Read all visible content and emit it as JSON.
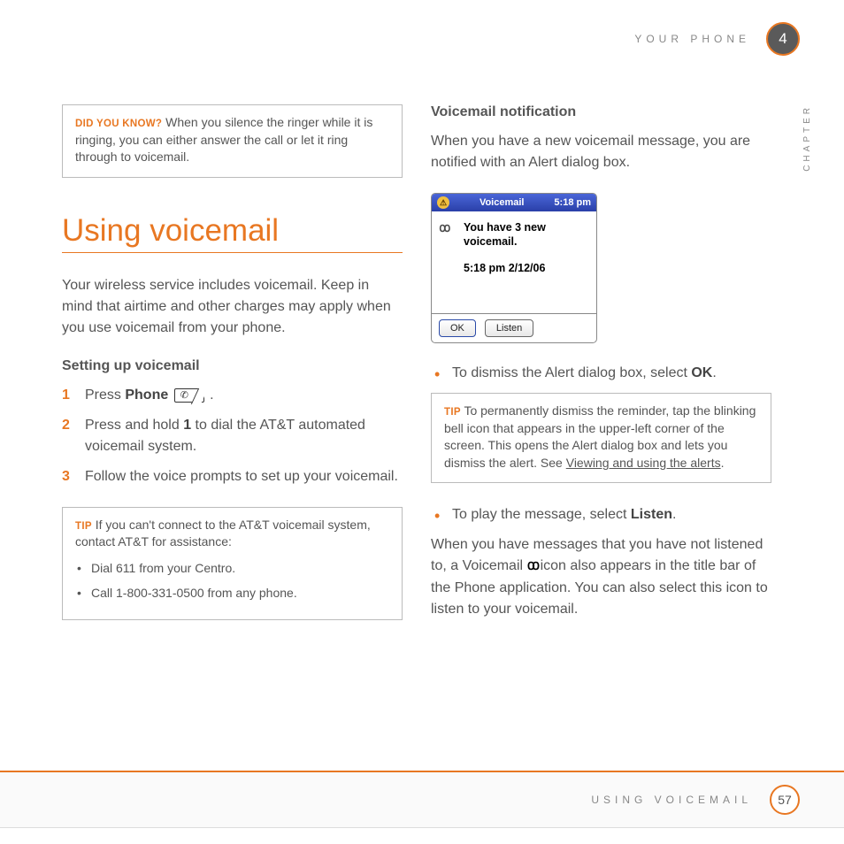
{
  "header": {
    "section": "YOUR PHONE",
    "chapter_num": "4",
    "chapter_label": "CHAPTER"
  },
  "col1": {
    "didyouknow": {
      "label": "DID YOU KNOW?",
      "text": "When you silence the ringer while it is ringing, you can either answer the call or let it ring through to voicemail."
    },
    "title": "Using voicemail",
    "intro": "Your wireless service includes voicemail. Keep in mind that airtime and other charges may apply when you use voicemail from your phone.",
    "setup_head": "Setting up voicemail",
    "step1_a": "Press ",
    "step1_b": "Phone",
    "step1_c": " .",
    "step2_a": "Press and hold ",
    "step2_b": "1",
    "step2_c": " to dial the AT&T automated voicemail system.",
    "step3": "Follow the voice prompts to set up your voicemail.",
    "tip": {
      "label": "TIP",
      "text": "If you can't connect to the AT&T voicemail system, contact AT&T for assistance:",
      "b1": "Dial 611 from your Centro.",
      "b2": "Call 1-800-331-0500 from any phone."
    }
  },
  "col2": {
    "notif_head": "Voicemail notification",
    "notif_text": "When you have a new voicemail message, you are notified with an Alert dialog box.",
    "screenshot": {
      "bell": "⚠",
      "title": "Voicemail",
      "time": "5:18 pm",
      "vm_icon": "ꙩꙩ",
      "msg": "You have 3 new voicemail.",
      "date": "5:18 pm 2/12/06",
      "ok": "OK",
      "listen": "Listen"
    },
    "bul1_a": "To dismiss the Alert dialog box, select ",
    "bul1_b": "OK",
    "bul1_c": ".",
    "tip": {
      "label": "TIP",
      "text_a": "To permanently dismiss the reminder, tap the blinking bell icon that appears in the upper-left corner of the screen. This opens the Alert dialog box and lets you dismiss the alert. See ",
      "link": "Viewing and using the alerts",
      "text_b": "."
    },
    "bul2_a": "To play the message, select ",
    "bul2_b": "Listen",
    "bul2_c": ".",
    "para_a": "When you have messages that you have not listened to, a Voicemail ",
    "para_b": " icon also appears in the title bar of the Phone application. You can also select this icon to listen to your voicemail."
  },
  "footer": {
    "text": "USING VOICEMAIL",
    "page": "57"
  }
}
